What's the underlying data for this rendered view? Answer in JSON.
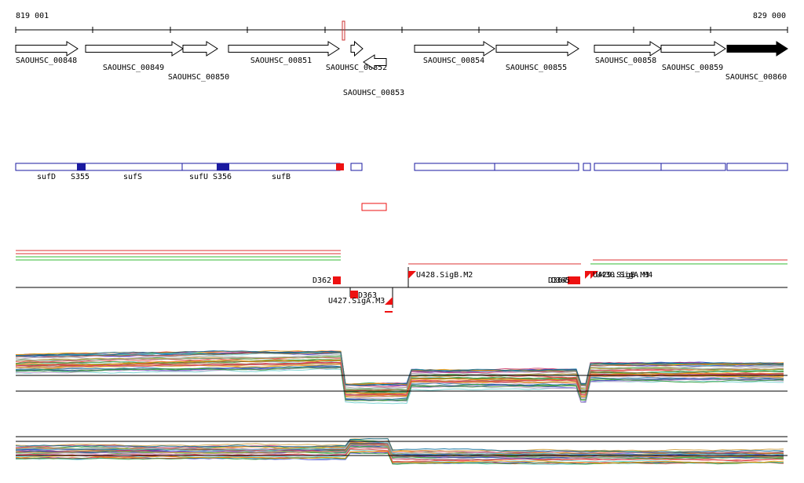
{
  "coordinates": {
    "start": "819 001",
    "end": "829 000"
  },
  "colors": {
    "ink": "#000000",
    "operon": "#1a1aa0",
    "promoter": "#ee1111",
    "gene_fill": "#ffffff",
    "gene_fill_dark": "#000000",
    "line_red": "#dd3333",
    "line_green": "#33bb33"
  },
  "genes": [
    {
      "id": "g848",
      "label": "SAOUHSC_00848",
      "strand": "+"
    },
    {
      "id": "g849",
      "label": "SAOUHSC_00849",
      "strand": "+"
    },
    {
      "id": "g850",
      "label": "SAOUHSC_00850",
      "strand": "+"
    },
    {
      "id": "g851",
      "label": "SAOUHSC_00851",
      "strand": "+"
    },
    {
      "id": "g852",
      "label": "SAOUHSC_00852",
      "strand": "+"
    },
    {
      "id": "g853",
      "label": "SAOUHSC_00853",
      "strand": "-"
    },
    {
      "id": "g854",
      "label": "SAOUHSC_00854",
      "strand": "+"
    },
    {
      "id": "g855",
      "label": "SAOUHSC_00855",
      "strand": "+"
    },
    {
      "id": "g858",
      "label": "SAOUHSC_00858",
      "strand": "+"
    },
    {
      "id": "g859",
      "label": "SAOUHSC_00859",
      "strand": "+"
    },
    {
      "id": "g860",
      "label": "SAOUHSC_00860",
      "strand": "+"
    }
  ],
  "operon_labels": [
    "sufD",
    "S355",
    "sufS",
    "sufU",
    "S356",
    "sufB"
  ],
  "promoter_labels": [
    "D362",
    "D363",
    "U427.SigA.M3",
    "U428.SigB.M2",
    "D364",
    "D365",
    "U429.SigB.M3",
    "U430.SigA.M4"
  ]
}
